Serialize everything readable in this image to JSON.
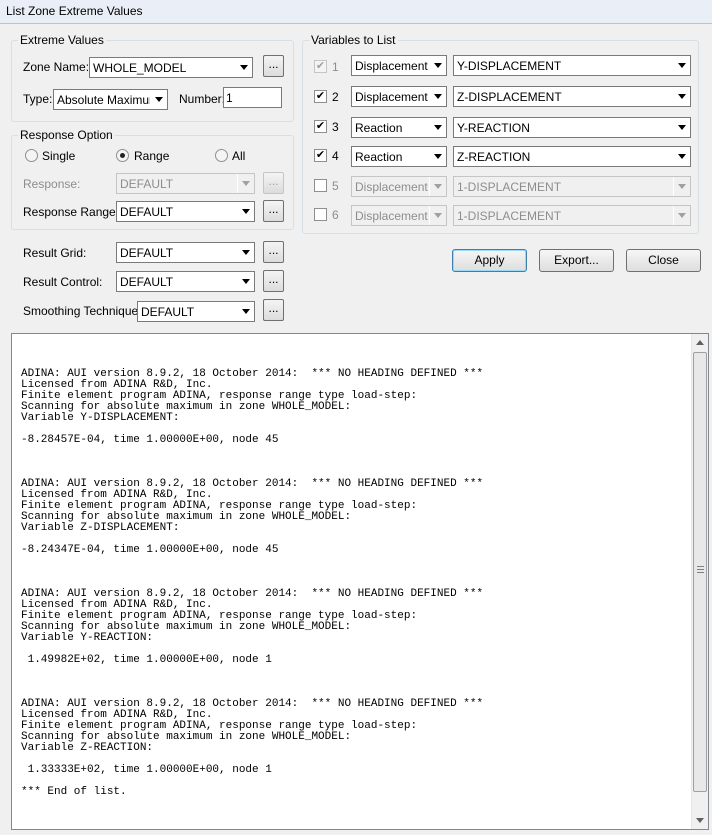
{
  "window": {
    "title": "List Zone Extreme Values"
  },
  "extreme_values": {
    "legend": "Extreme Values",
    "zone_label": "Zone Name:",
    "zone_value": "WHOLE_MODEL",
    "type_label": "Type:",
    "type_value": "Absolute Maximum",
    "number_label": "Number:",
    "number_value": "1"
  },
  "response_option": {
    "legend": "Response Option",
    "radios": [
      {
        "label": "Single",
        "checked": false
      },
      {
        "label": "Range",
        "checked": true
      },
      {
        "label": "All",
        "checked": false
      }
    ],
    "response_label": "Response:",
    "response_value": "DEFAULT",
    "range_label": "Response Range:",
    "range_value": "DEFAULT"
  },
  "result_settings": {
    "grid_label": "Result Grid:",
    "grid_value": "DEFAULT",
    "control_label": "Result Control:",
    "control_value": "DEFAULT",
    "smoothing_label": "Smoothing Technique:",
    "smoothing_value": "DEFAULT"
  },
  "dots_label": "...",
  "check_mark": "✔",
  "variables": {
    "legend": "Variables to List",
    "rows": [
      {
        "index": "1",
        "checked": true,
        "enabled": false,
        "category": "Displacement",
        "variable": "Y-DISPLACEMENT"
      },
      {
        "index": "2",
        "checked": true,
        "enabled": true,
        "category": "Displacement",
        "variable": "Z-DISPLACEMENT"
      },
      {
        "index": "3",
        "checked": true,
        "enabled": true,
        "category": "Reaction",
        "variable": "Y-REACTION"
      },
      {
        "index": "4",
        "checked": true,
        "enabled": true,
        "category": "Reaction",
        "variable": "Z-REACTION"
      },
      {
        "index": "5",
        "checked": false,
        "enabled": false,
        "category": "Displacement",
        "variable": "1-DISPLACEMENT"
      },
      {
        "index": "6",
        "checked": false,
        "enabled": false,
        "category": "Displacement",
        "variable": "1-DISPLACEMENT"
      }
    ]
  },
  "buttons": {
    "apply": "Apply",
    "export": "Export...",
    "close": "Close"
  },
  "output_text": "ADINA: AUI version 8.9.2, 18 October 2014:  *** NO HEADING DEFINED ***\nLicensed from ADINA R&D, Inc.\nFinite element program ADINA, response range type load-step:\nScanning for absolute maximum in zone WHOLE_MODEL:\nVariable Y-DISPLACEMENT:\n\n-8.28457E-04, time 1.00000E+00, node 45\n\n\n\nADINA: AUI version 8.9.2, 18 October 2014:  *** NO HEADING DEFINED ***\nLicensed from ADINA R&D, Inc.\nFinite element program ADINA, response range type load-step:\nScanning for absolute maximum in zone WHOLE_MODEL:\nVariable Z-DISPLACEMENT:\n\n-8.24347E-04, time 1.00000E+00, node 45\n\n\n\nADINA: AUI version 8.9.2, 18 October 2014:  *** NO HEADING DEFINED ***\nLicensed from ADINA R&D, Inc.\nFinite element program ADINA, response range type load-step:\nScanning for absolute maximum in zone WHOLE_MODEL:\nVariable Y-REACTION:\n\n 1.49982E+02, time 1.00000E+00, node 1\n\n\n\nADINA: AUI version 8.9.2, 18 October 2014:  *** NO HEADING DEFINED ***\nLicensed from ADINA R&D, Inc.\nFinite element program ADINA, response range type load-step:\nScanning for absolute maximum in zone WHOLE_MODEL:\nVariable Z-REACTION:\n\n 1.33333E+02, time 1.00000E+00, node 1\n\n*** End of list."
}
